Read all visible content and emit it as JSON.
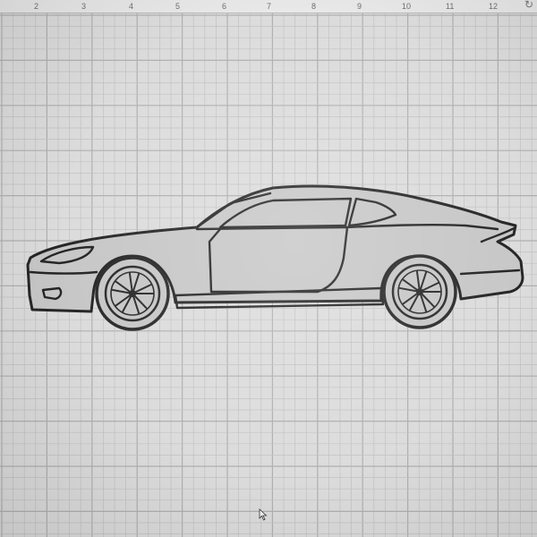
{
  "ruler": {
    "marks": [
      "2",
      "3",
      "4",
      "5",
      "6",
      "7",
      "8",
      "9",
      "10",
      "11",
      "12"
    ]
  },
  "canvas": {
    "grid_color": "#c2c2c2",
    "major_grid_color": "#b0b0b0",
    "background": "#dcdcdc"
  },
  "car": {
    "body_fill": "#c7c7c7",
    "outline_color": "#262626",
    "wheel_color": "#2a2a2a"
  },
  "icons": {
    "ruler_corner": "refresh-icon",
    "pointer": "mouse-cursor-icon"
  }
}
